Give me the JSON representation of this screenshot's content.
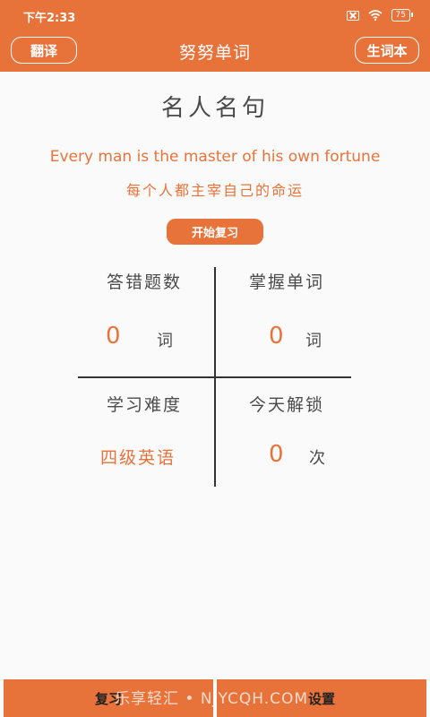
{
  "status_bar": {
    "time": "下午2:33",
    "battery": "75",
    "icons": [
      "sim-off-icon",
      "wifi-icon",
      "battery-icon"
    ]
  },
  "header": {
    "title": "努努单词",
    "left_button": "翻译",
    "right_button": "生词本"
  },
  "quote": {
    "title": "名人名句",
    "english": "Every man is the master of his own  fortune",
    "chinese": "每个人都主宰自己的命运"
  },
  "start_review_label": "开始复习",
  "stats": {
    "wrong_answers": {
      "label": "答错题数",
      "value": "0",
      "unit": "词"
    },
    "mastered_words": {
      "label": "掌握单词",
      "value": "0",
      "unit": "词"
    },
    "difficulty": {
      "label": "学习难度",
      "value": "四级英语"
    },
    "unlocks_today": {
      "label": "今天解锁",
      "value": "0",
      "unit": "次"
    }
  },
  "bottom_nav": {
    "review": "复习",
    "settings": "设置"
  },
  "watermark": "乐享轻汇 • NJYCQH.COM",
  "colors": {
    "accent": "#e8733a",
    "text": "#4a4a4a",
    "background": "#fafafa"
  }
}
